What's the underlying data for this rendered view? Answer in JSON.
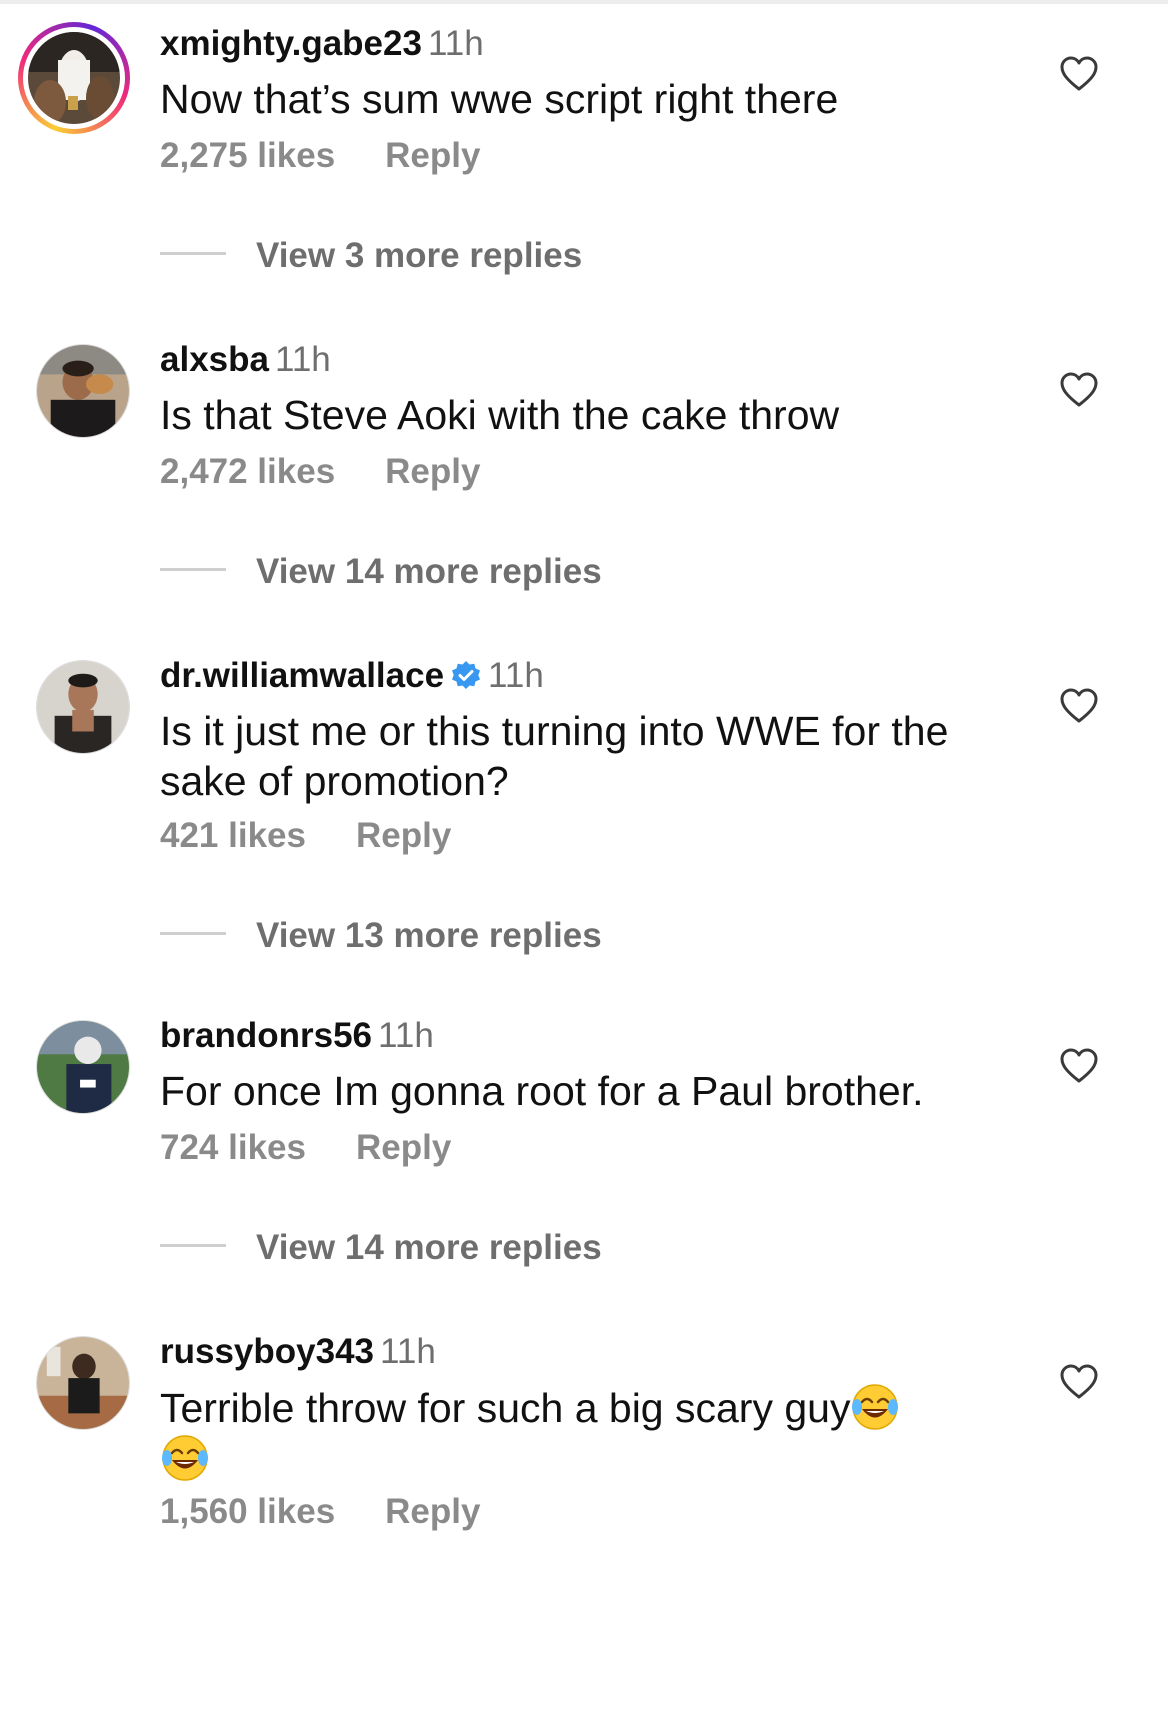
{
  "comments": [
    {
      "username": "xmighty.gabe23",
      "time": "11h",
      "text": "Now that’s sum wwe script right there",
      "likes": "2,275 likes",
      "reply_label": "Reply",
      "view_more": "View 3 more replies",
      "has_story": true,
      "verified": false
    },
    {
      "username": "alxsba",
      "time": "11h",
      "text": "Is that Steve Aoki with the cake throw",
      "likes": "2,472 likes",
      "reply_label": "Reply",
      "view_more": "View 14 more replies",
      "has_story": false,
      "verified": false
    },
    {
      "username": "dr.williamwallace",
      "time": "11h",
      "text": "Is it just me or this turning into WWE for the sake of promotion?",
      "likes": "421 likes",
      "reply_label": "Reply",
      "view_more": "View 13 more replies",
      "has_story": false,
      "verified": true
    },
    {
      "username": "brandonrs56",
      "time": "11h",
      "text": "For once Im gonna root for a Paul brother.",
      "likes": "724 likes",
      "reply_label": "Reply",
      "view_more": "View 14 more replies",
      "has_story": false,
      "verified": false
    },
    {
      "username": "russyboy343",
      "time": "11h",
      "text": "Terrible throw for such a big scary guy",
      "emoji": "face-with-tears-of-joy",
      "likes": "1,560 likes",
      "reply_label": "Reply",
      "has_story": false,
      "verified": false
    }
  ],
  "colors": {
    "text": "#111111",
    "muted": "#8a8a8a",
    "time": "#6e6e6e",
    "verified_blue": "#3897f0"
  }
}
